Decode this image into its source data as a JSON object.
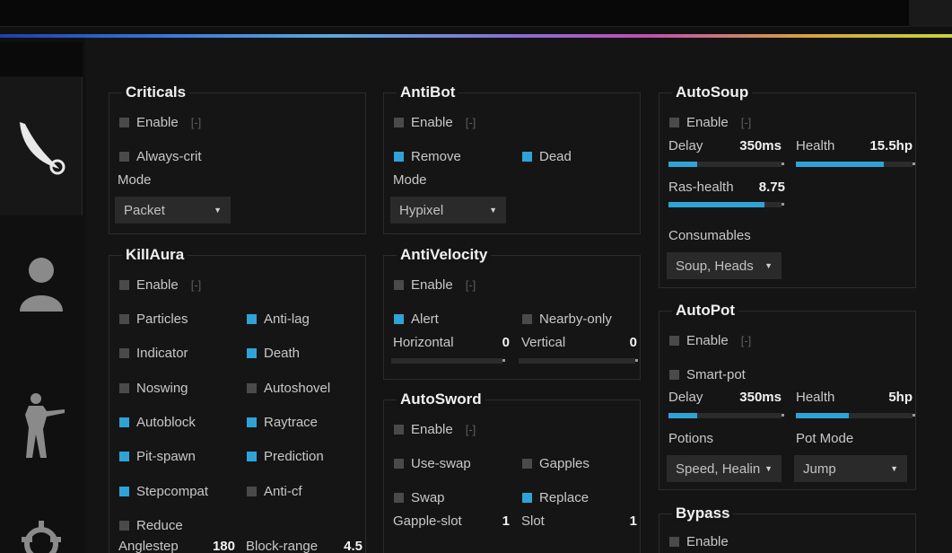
{
  "colors": {
    "accent": "#2fa3d6",
    "background": "#141414"
  },
  "sidebar": {
    "icons": [
      "knife-icon",
      "user-icon",
      "soldier-icon",
      "gear-icon"
    ]
  },
  "criticals": {
    "title": "Criticals",
    "enable": {
      "label": "Enable",
      "on": false,
      "bind": "[-]"
    },
    "always_crit": {
      "label": "Always-crit",
      "on": false
    },
    "mode_label": "Mode",
    "mode_value": "Packet"
  },
  "antibot": {
    "title": "AntiBot",
    "enable": {
      "label": "Enable",
      "on": false,
      "bind": "[-]"
    },
    "remove": {
      "label": "Remove",
      "on": true
    },
    "dead": {
      "label": "Dead",
      "on": true
    },
    "mode_label": "Mode",
    "mode_value": "Hypixel"
  },
  "autosoup": {
    "title": "AutoSoup",
    "enable": {
      "label": "Enable",
      "on": false,
      "bind": "[-]"
    },
    "delay": {
      "label": "Delay",
      "value": "350ms",
      "fraction": 0.25
    },
    "health": {
      "label": "Health",
      "value": "15.5hp",
      "fraction": 0.75
    },
    "ras_health": {
      "label": "Ras-health",
      "value": "8.75",
      "fraction": 0.85
    },
    "consumables_label": "Consumables",
    "consumables_value": "Soup, Heads"
  },
  "killaura": {
    "title": "KillAura",
    "enable": {
      "label": "Enable",
      "on": false,
      "bind": "[-]"
    },
    "left": [
      {
        "label": "Particles",
        "on": false
      },
      {
        "label": "Indicator",
        "on": false
      },
      {
        "label": "Noswing",
        "on": false
      },
      {
        "label": "Autoblock",
        "on": true
      },
      {
        "label": "Pit-spawn",
        "on": true
      },
      {
        "label": "Stepcompat",
        "on": true
      },
      {
        "label": "Reduce",
        "on": false
      }
    ],
    "right": [
      {
        "label": "Anti-lag",
        "on": true
      },
      {
        "label": "Death",
        "on": true
      },
      {
        "label": "Autoshovel",
        "on": false
      },
      {
        "label": "Raytrace",
        "on": true
      },
      {
        "label": "Prediction",
        "on": true
      },
      {
        "label": "Anti-cf",
        "on": false
      }
    ],
    "anglestep": {
      "label": "Anglestep",
      "value": "180"
    },
    "block_range": {
      "label": "Block-range",
      "value": "4.5"
    }
  },
  "antivelocity": {
    "title": "AntiVelocity",
    "enable": {
      "label": "Enable",
      "on": false,
      "bind": "[-]"
    },
    "alert": {
      "label": "Alert",
      "on": true
    },
    "nearby_only": {
      "label": "Nearby-only",
      "on": false
    },
    "horizontal": {
      "label": "Horizontal",
      "value": "0",
      "fraction": 0
    },
    "vertical": {
      "label": "Vertical",
      "value": "0",
      "fraction": 0
    }
  },
  "autosword": {
    "title": "AutoSword",
    "enable": {
      "label": "Enable",
      "on": false,
      "bind": "[-]"
    },
    "use_swap": {
      "label": "Use-swap",
      "on": false
    },
    "gapples": {
      "label": "Gapples",
      "on": false
    },
    "swap": {
      "label": "Swap",
      "on": false
    },
    "replace": {
      "label": "Replace",
      "on": true
    },
    "gapple_slot": {
      "label": "Gapple-slot",
      "value": "1"
    },
    "slot": {
      "label": "Slot",
      "value": "1"
    }
  },
  "autopot": {
    "title": "AutoPot",
    "enable": {
      "label": "Enable",
      "on": false,
      "bind": "[-]"
    },
    "smart_pot": {
      "label": "Smart-pot",
      "on": false
    },
    "delay": {
      "label": "Delay",
      "value": "350ms",
      "fraction": 0.25
    },
    "health": {
      "label": "Health",
      "value": "5hp",
      "fraction": 0.45
    },
    "potions_label": "Potions",
    "potions_value": "Speed, Healin",
    "pot_mode_label": "Pot Mode",
    "pot_mode_value": "Jump"
  },
  "bypass": {
    "title": "Bypass",
    "enable": {
      "label": "Enable",
      "on": false
    }
  }
}
